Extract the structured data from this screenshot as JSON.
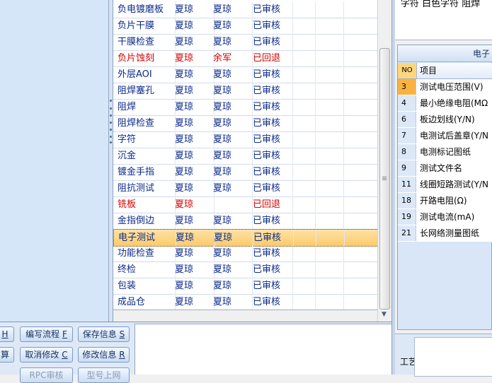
{
  "process_grid": {
    "rows": [
      {
        "step": "负电镀磨板",
        "p1": "夏琼",
        "p2": "夏琼",
        "status": "已审核",
        "alert": false
      },
      {
        "step": "负片干膜",
        "p1": "夏琼",
        "p2": "夏琼",
        "status": "已审核",
        "alert": false
      },
      {
        "step": "干膜检查",
        "p1": "夏琼",
        "p2": "夏琼",
        "status": "已审核",
        "alert": false
      },
      {
        "step": "负片蚀刻",
        "p1": "夏琼",
        "p2": "余军",
        "status": "已回退",
        "alert": true
      },
      {
        "step": "外层AOI",
        "p1": "夏琼",
        "p2": "夏琼",
        "status": "已审核",
        "alert": false
      },
      {
        "step": "阻焊塞孔",
        "p1": "夏琼",
        "p2": "夏琼",
        "status": "已审核",
        "alert": false
      },
      {
        "step": "阻焊",
        "p1": "夏琼",
        "p2": "夏琼",
        "status": "已审核",
        "alert": false
      },
      {
        "step": "阻焊检查",
        "p1": "夏琼",
        "p2": "夏琼",
        "status": "已审核",
        "alert": false
      },
      {
        "step": "字符",
        "p1": "夏琼",
        "p2": "夏琼",
        "status": "已审核",
        "alert": false
      },
      {
        "step": "沉金",
        "p1": "夏琼",
        "p2": "夏琼",
        "status": "已审核",
        "alert": false
      },
      {
        "step": "镀金手指",
        "p1": "夏琼",
        "p2": "夏琼",
        "status": "已审核",
        "alert": false
      },
      {
        "step": "阻抗测试",
        "p1": "夏琼",
        "p2": "夏琼",
        "status": "已审核",
        "alert": false
      },
      {
        "step": "铣板",
        "p1": "夏琼",
        "p2": "",
        "status": "已回退",
        "alert": true
      },
      {
        "step": "金指倒边",
        "p1": "夏琼",
        "p2": "夏琼",
        "status": "已审核",
        "alert": false
      },
      {
        "step": "电子测试",
        "p1": "夏琼",
        "p2": "夏琼",
        "status": "已审核",
        "alert": false,
        "selected": true
      },
      {
        "step": "功能检查",
        "p1": "夏琼",
        "p2": "夏琼",
        "status": "已审核",
        "alert": false
      },
      {
        "step": "终检",
        "p1": "夏琼",
        "p2": "夏琼",
        "status": "已审核",
        "alert": false
      },
      {
        "step": "包装",
        "p1": "夏琼",
        "p2": "夏琼",
        "status": "已审核",
        "alert": false
      },
      {
        "step": "成品仓",
        "p1": "夏琼",
        "p2": "夏琼",
        "status": "已审核",
        "alert": false
      }
    ]
  },
  "buttons": {
    "row1": [
      {
        "label": "",
        "hotkey": "H",
        "name": "partial-button-h"
      },
      {
        "label": "编写流程",
        "hotkey": "F",
        "name": "write-flow-button"
      },
      {
        "label": "保存信息",
        "hotkey": "S",
        "name": "save-info-button"
      }
    ],
    "row2": [
      {
        "label": "算",
        "hotkey": "",
        "name": "partial-button-calc"
      },
      {
        "label": "取消修改",
        "hotkey": "C",
        "name": "cancel-edit-button"
      },
      {
        "label": "修改信息",
        "hotkey": "R",
        "name": "modify-info-button"
      }
    ],
    "row3": [
      {
        "label": "RPC审核",
        "name": "rpc-review-button"
      },
      {
        "label": "型号上网",
        "name": "model-online-button"
      }
    ]
  },
  "right_top": {
    "text": "字符  白色字符  阻焊"
  },
  "right_panel": {
    "title": "电子",
    "col_no": "NO",
    "col_item": "项目",
    "rows": [
      {
        "no": "3",
        "item": "测试电压范围(V)",
        "selected": true
      },
      {
        "no": "4",
        "item": "最小绝缘电阻(MΩ"
      },
      {
        "no": "6",
        "item": "板边划线(Y/N)"
      },
      {
        "no": "7",
        "item": "电测试后盖章(Y/N"
      },
      {
        "no": "8",
        "item": "电测标记图纸"
      },
      {
        "no": "9",
        "item": "测试文件名"
      },
      {
        "no": "11",
        "item": "线圈短路测试(Y/N"
      },
      {
        "no": "18",
        "item": "开路电阻(Ω)"
      },
      {
        "no": "19",
        "item": "测试电流(mA)"
      },
      {
        "no": "21",
        "item": "长网络测量图纸"
      }
    ],
    "bottom_label": "工艺"
  }
}
